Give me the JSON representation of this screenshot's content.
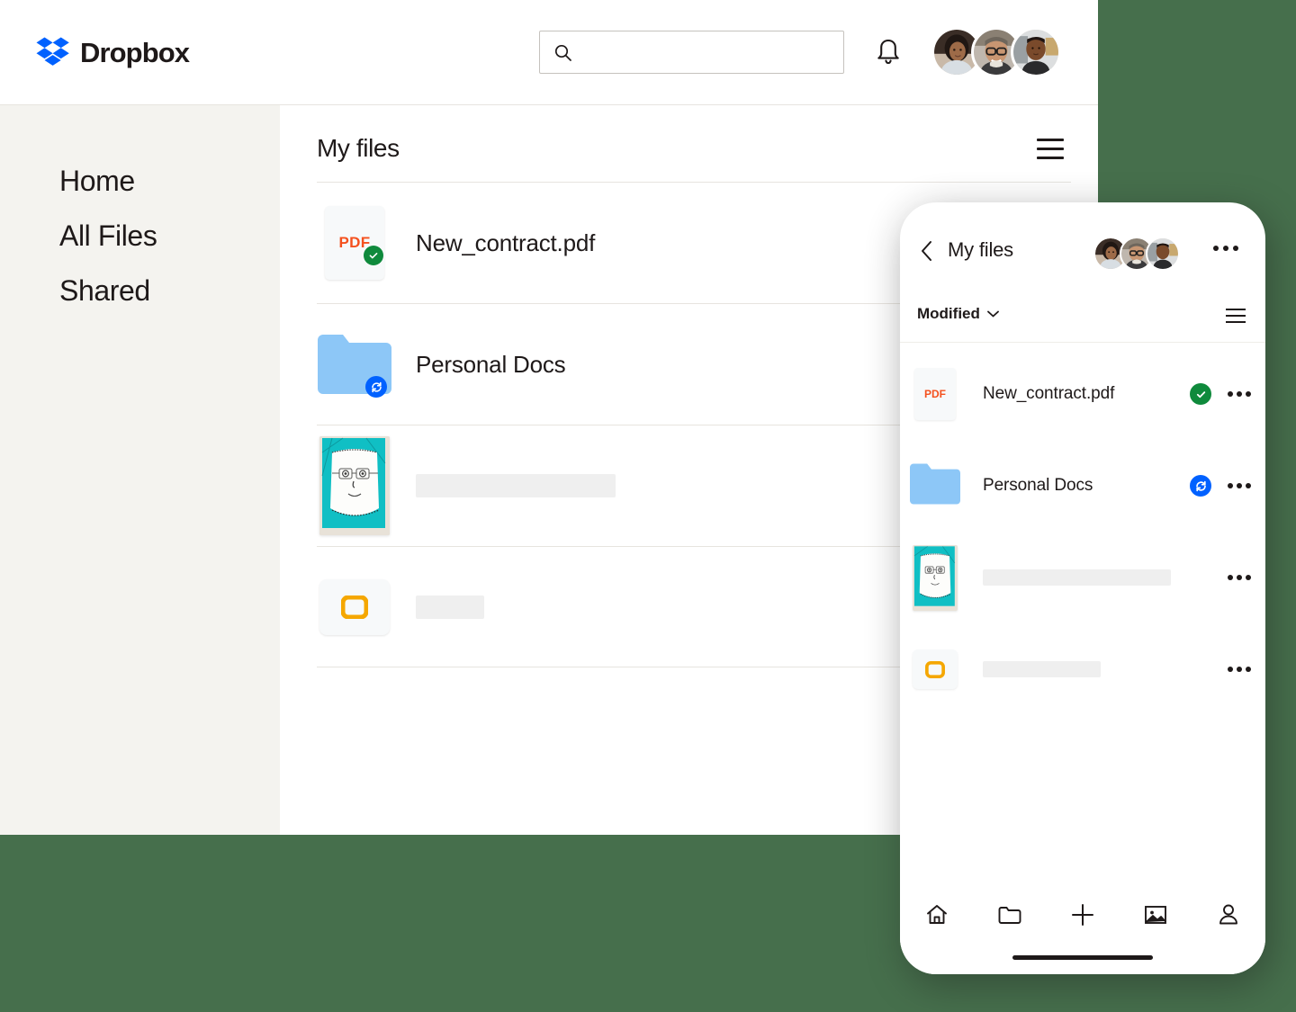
{
  "brand": {
    "name": "Dropbox",
    "logo_color": "#0061FF",
    "accent_green": "#466F4C"
  },
  "desktop": {
    "header": {
      "logo_text": "Dropbox",
      "search": {
        "value": "",
        "placeholder": "",
        "icon": "search-icon"
      },
      "notifications_icon": "bell-icon",
      "avatars": [
        {
          "name": "avatar-1"
        },
        {
          "name": "avatar-2"
        },
        {
          "name": "avatar-3"
        }
      ]
    },
    "sidebar": {
      "items": [
        {
          "label": "Home",
          "name": "sidebar-item-home"
        },
        {
          "label": "All Files",
          "name": "sidebar-item-all-files"
        },
        {
          "label": "Shared",
          "name": "sidebar-item-shared"
        }
      ]
    },
    "main": {
      "title": "My files",
      "view_toggle_icon": "list-view-icon",
      "rows": [
        {
          "name": "New_contract.pdf",
          "icon": "pdf-file-icon",
          "icon_label": "PDF",
          "status": "synced",
          "status_icon": "check-circle-icon",
          "placeholder": false
        },
        {
          "name": "Personal Docs",
          "icon": "folder-icon",
          "icon_label": "",
          "status": "syncing",
          "status_icon": "sync-circle-icon",
          "placeholder": false
        },
        {
          "name": "",
          "icon": "photo-thumbnail",
          "icon_label": "",
          "status": "",
          "status_icon": "",
          "placeholder": true,
          "placeholder_width": 222
        },
        {
          "name": "",
          "icon": "presentation-file-icon",
          "icon_label": "",
          "status": "",
          "status_icon": "",
          "placeholder": true,
          "placeholder_width": 76
        }
      ]
    }
  },
  "phone": {
    "header": {
      "back_icon": "chevron-left-icon",
      "title": "My files",
      "avatars": [
        {
          "name": "avatar-1"
        },
        {
          "name": "avatar-2"
        },
        {
          "name": "avatar-3"
        }
      ],
      "overflow_icon": "more-horizontal-icon"
    },
    "sortbar": {
      "sort_label": "Modified",
      "sort_chevron_icon": "chevron-down-icon",
      "view_toggle_icon": "list-view-icon"
    },
    "rows": [
      {
        "name": "New_contract.pdf",
        "icon": "pdf-file-icon",
        "icon_label": "PDF",
        "status": "synced",
        "status_icon": "check-circle-icon",
        "overflow_icon": "more-horizontal-icon",
        "placeholder": false
      },
      {
        "name": "Personal Docs",
        "icon": "folder-icon",
        "icon_label": "",
        "status": "syncing",
        "status_icon": "sync-circle-icon",
        "overflow_icon": "more-horizontal-icon",
        "placeholder": false
      },
      {
        "name": "",
        "icon": "photo-thumbnail",
        "icon_label": "",
        "status": "",
        "status_icon": "",
        "overflow_icon": "more-horizontal-icon",
        "placeholder": true,
        "placeholder_width": 209
      },
      {
        "name": "",
        "icon": "presentation-file-icon",
        "icon_label": "",
        "status": "",
        "status_icon": "",
        "overflow_icon": "more-horizontal-icon",
        "placeholder": true,
        "placeholder_width": 131
      }
    ],
    "nav": [
      {
        "name": "nav-home",
        "icon": "home-icon"
      },
      {
        "name": "nav-files",
        "icon": "folder-icon"
      },
      {
        "name": "nav-create",
        "icon": "plus-icon"
      },
      {
        "name": "nav-photos",
        "icon": "photos-icon"
      },
      {
        "name": "nav-account",
        "icon": "person-icon"
      }
    ],
    "home_indicator": "home-indicator-bar"
  },
  "colors": {
    "pdf_red": "#F4511E",
    "folder_blue": "#8DC7F7",
    "sync_blue": "#0061FF",
    "synced_green": "#0F8A3C",
    "slide_yellow": "#F5A700",
    "sidebar_bg": "#F4F3EF",
    "photo_teal": "#10BFC4"
  }
}
